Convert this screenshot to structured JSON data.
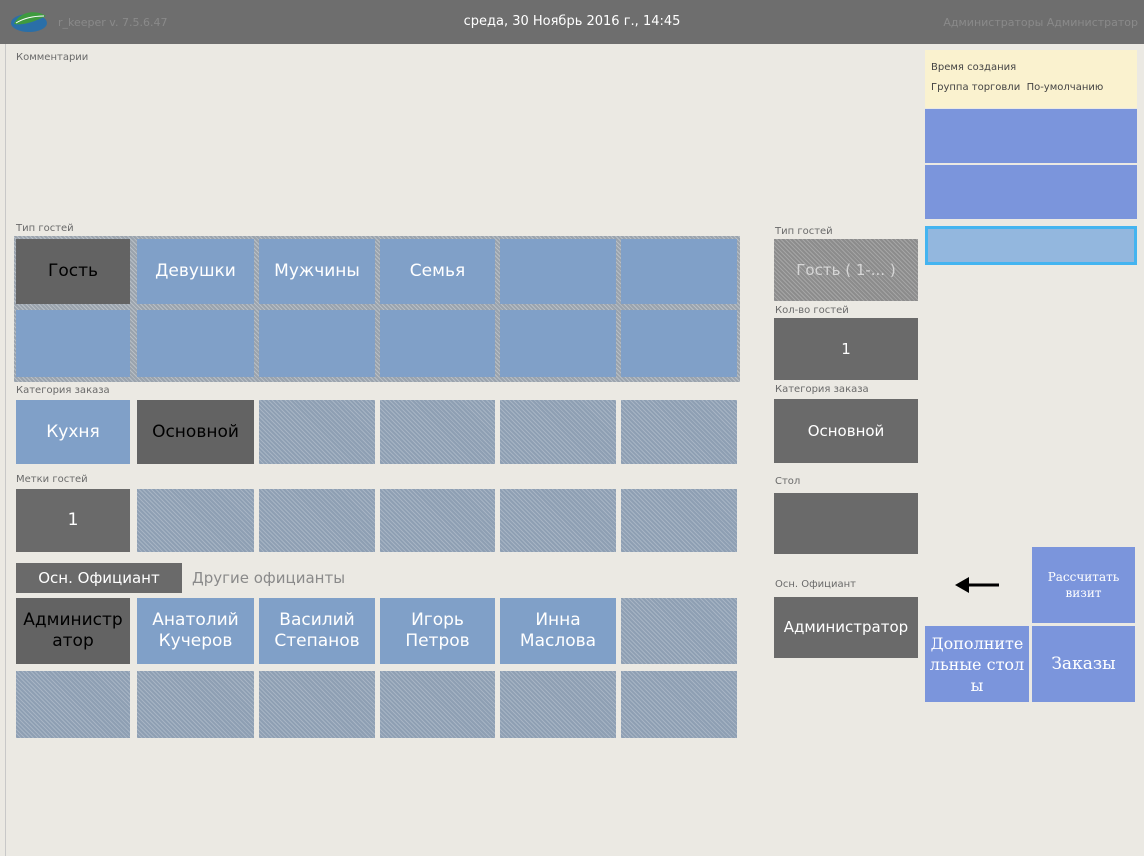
{
  "topbar": {
    "version": "r_keeper v. 7.5.6.47",
    "datetime": "среда, 30 Ноябрь 2016 г., 14:45",
    "user": "Администраторы Администратор"
  },
  "labels": {
    "comments": "Комментарии",
    "guest_type": "Тип гостей",
    "order_category": "Категория заказа",
    "guest_marks": "Метки гостей",
    "other_waiters": "Другие официанты"
  },
  "guest_types": [
    "Гость",
    "Девушки",
    "Мужчины",
    "Семья"
  ],
  "order_categories": [
    "Кухня",
    "Основной"
  ],
  "guest_marks": [
    "1"
  ],
  "waiter_tab": "Осн. Официант",
  "waiters": [
    {
      "line1": "Администр",
      "line2": "атор"
    },
    {
      "line1": "Анатолий",
      "line2": "Кучеров"
    },
    {
      "line1": "Василий",
      "line2": "Степанов"
    },
    {
      "line1": "Игорь",
      "line2": "Петров"
    },
    {
      "line1": "Инна",
      "line2": "Маслова"
    }
  ],
  "summary": {
    "guest_type_label": "Тип гостей",
    "guest_type_value": "Гость ( 1-... )",
    "guest_count_label": "Кол-во гостей",
    "guest_count_value": "1",
    "order_category_label": "Категория заказа",
    "order_category_value": "Основной",
    "table_label": "Стол",
    "table_value": "",
    "waiter_label": "Осн. Официант",
    "waiter_value": "Администратор"
  },
  "right_panel": {
    "created_label": "Время создания",
    "trade_group_label": "Группа торговли",
    "trade_group_value": "По-умолчанию",
    "calc_visit": "Рассчитать визит",
    "extra_tables": "Дополнительные столы",
    "orders": "Заказы"
  },
  "icons": {
    "logo": "leaf-logo-icon",
    "back": "arrow-left-icon"
  },
  "colors": {
    "tile_blue": "#80a0c8",
    "tile_dark": "#636363",
    "right_blue": "#7b95dc",
    "info_bg": "#faf2cf",
    "topbar": "#6e6e6e"
  }
}
